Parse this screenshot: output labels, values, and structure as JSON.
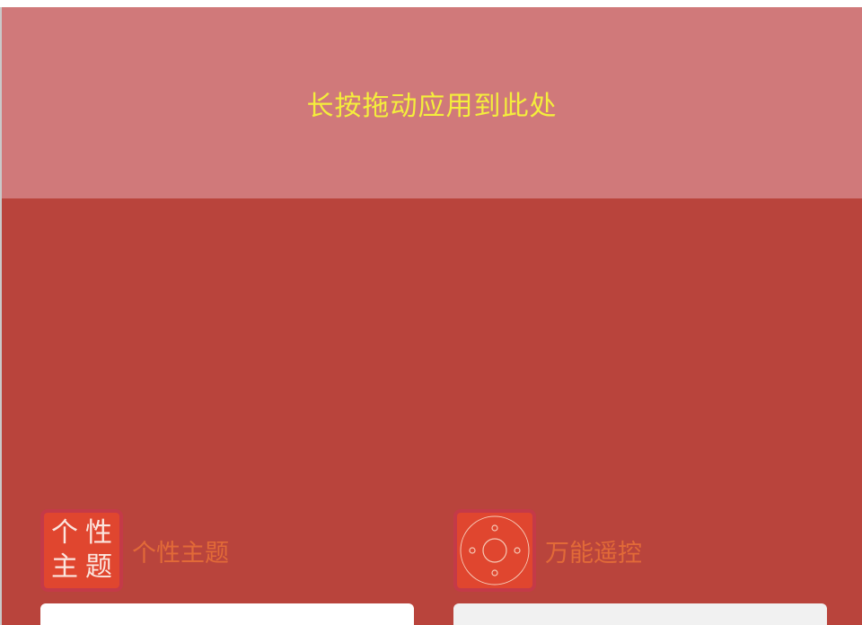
{
  "drop_zone": {
    "hint": "长按拖动应用到此处"
  },
  "apps": [
    {
      "label": "个性主题",
      "icon": "theme-calligraphy-icon",
      "icon_chars": [
        "个",
        "性",
        "主",
        "题"
      ]
    },
    {
      "label": "万能遥控",
      "icon": "remote-control-icon"
    }
  ],
  "colors": {
    "drop_zone_bg": "#d0797a",
    "drop_zone_text": "#f4ee3c",
    "main_bg": "#b9443c",
    "app_label": "#e26a38",
    "icon_frame": "#c43a48",
    "icon_fill": "#e0462f"
  }
}
